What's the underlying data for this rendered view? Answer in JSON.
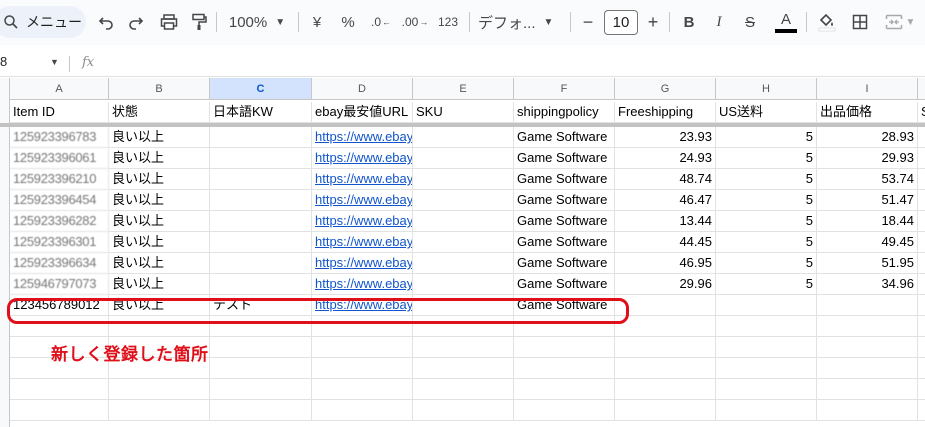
{
  "toolbar": {
    "menu_search_label": "メニュー",
    "zoom": "100%",
    "currency": "¥",
    "percent": "%",
    "decrease_decimal": ".0",
    "increase_decimal": ".00",
    "number_format": "123",
    "font_name": "デフォ...",
    "font_size": "10",
    "minus": "−",
    "plus": "+",
    "bold": "B",
    "italic": "I",
    "strike": "S",
    "text_color": "A"
  },
  "formula_bar": {
    "cell_ref": "8",
    "fx": "fx",
    "content": ""
  },
  "grid": {
    "column_letters": [
      "A",
      "B",
      "C",
      "D",
      "E",
      "F",
      "G",
      "H",
      "I",
      "S"
    ],
    "headers": [
      "Item ID",
      "状態",
      "日本語KW",
      "ebay最安値URL",
      "SKU",
      "shippingpolicy",
      "Freeshipping",
      "US送料",
      "出品価格",
      "S"
    ],
    "rows": [
      [
        "125923396783",
        "良い以上",
        "",
        "https://www.ebay.com/sch/i.html?",
        "",
        "Game Software",
        "23.93",
        "5",
        "28.93"
      ],
      [
        "125923396061",
        "良い以上",
        "",
        "https://www.ebay.com/sch/i.html?",
        "",
        "Game Software",
        "24.93",
        "5",
        "29.93"
      ],
      [
        "125923396210",
        "良い以上",
        "",
        "https://www.ebay.com/sch/i.html?",
        "",
        "Game Software",
        "48.74",
        "5",
        "53.74"
      ],
      [
        "125923396454",
        "良い以上",
        "",
        "https://www.ebay.com/sch/i.html?",
        "",
        "Game Software",
        "46.47",
        "5",
        "51.47"
      ],
      [
        "125923396282",
        "良い以上",
        "",
        "https://www.ebay.com/sch/i.html?",
        "",
        "Game Software",
        "13.44",
        "5",
        "18.44"
      ],
      [
        "125923396301",
        "良い以上",
        "",
        "https://www.ebay.com/sch/i.html?",
        "",
        "Game Software",
        "44.45",
        "5",
        "49.45"
      ],
      [
        "125923396634",
        "良い以上",
        "",
        "https://www.ebay.com/sch/i.html?",
        "",
        "Game Software",
        "46.95",
        "5",
        "51.95"
      ],
      [
        "125946797073",
        "良い以上",
        "",
        "https://www.ebay.com/sch/i.html?",
        "",
        "Game Software",
        "29.96",
        "5",
        "34.96"
      ],
      [
        "123456789012",
        "良い以上",
        "テスト",
        "https://www.ebay.com/sch/i.html?",
        "",
        "Game Software",
        "",
        "",
        ""
      ]
    ]
  },
  "annotation": "新しく登録した箇所",
  "colors": {
    "accent_red": "#e0101a",
    "link": "#1155cc",
    "selected_col": "#d3e3fd"
  }
}
